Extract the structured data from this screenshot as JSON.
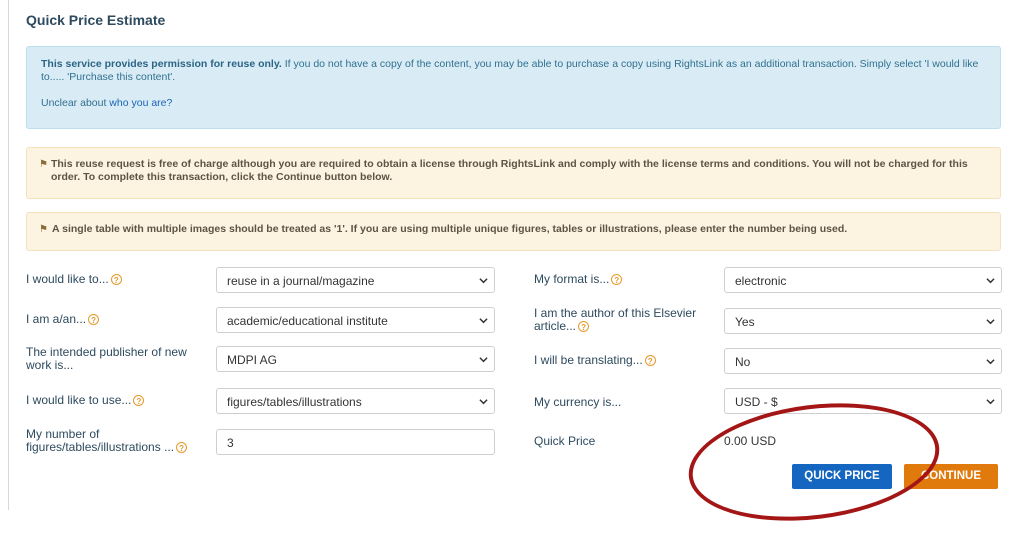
{
  "title": "Quick Price Estimate",
  "info": {
    "bold": "This service provides permission for reuse only.",
    "text": " If you do not have a copy of the content, you may be able to purchase a copy using RightsLink as an additional transaction. Simply select 'I would like to..... 'Purchase this content'.",
    "unclear_prefix": "Unclear about ",
    "unclear_link": "who you are?"
  },
  "warning1": "This reuse request is free of charge although you are required to obtain a license through RightsLink and comply with the license terms and conditions. You will not be charged for this order. To complete this transaction, click the Continue button below.",
  "warning2": "A single table with multiple images should be treated as '1'. If you are using multiple unique figures, tables or illustrations, please enter the number being used.",
  "form": {
    "would_like_label": "I would like to...",
    "would_like_value": "reuse in a journal/magazine",
    "i_am_label": "I am a/an...",
    "i_am_value": "academic/educational institute",
    "publisher_label": "The intended publisher of new work is...",
    "publisher_value": "MDPI AG",
    "use_label": "I would like to use...",
    "use_value": "figures/tables/illustrations",
    "number_label": "My number of figures/tables/illustrations ...",
    "number_value": "3",
    "format_label": "My format is...",
    "format_value": "electronic",
    "author_label": "I am the author of this Elsevier article...",
    "author_value": "Yes",
    "translating_label": "I will be translating...",
    "translating_value": "No",
    "currency_label": "My currency is...",
    "currency_value": "USD - $",
    "quick_price_label": "Quick Price",
    "quick_price_value": "0.00 USD"
  },
  "buttons": {
    "quick_price": "QUICK PRICE",
    "continue": "CONTINUE"
  },
  "help_glyph": "?",
  "colors": {
    "annotation_circle": "#a41616",
    "primary_button": "#1566c0",
    "continue_button": "#e07a0c"
  }
}
